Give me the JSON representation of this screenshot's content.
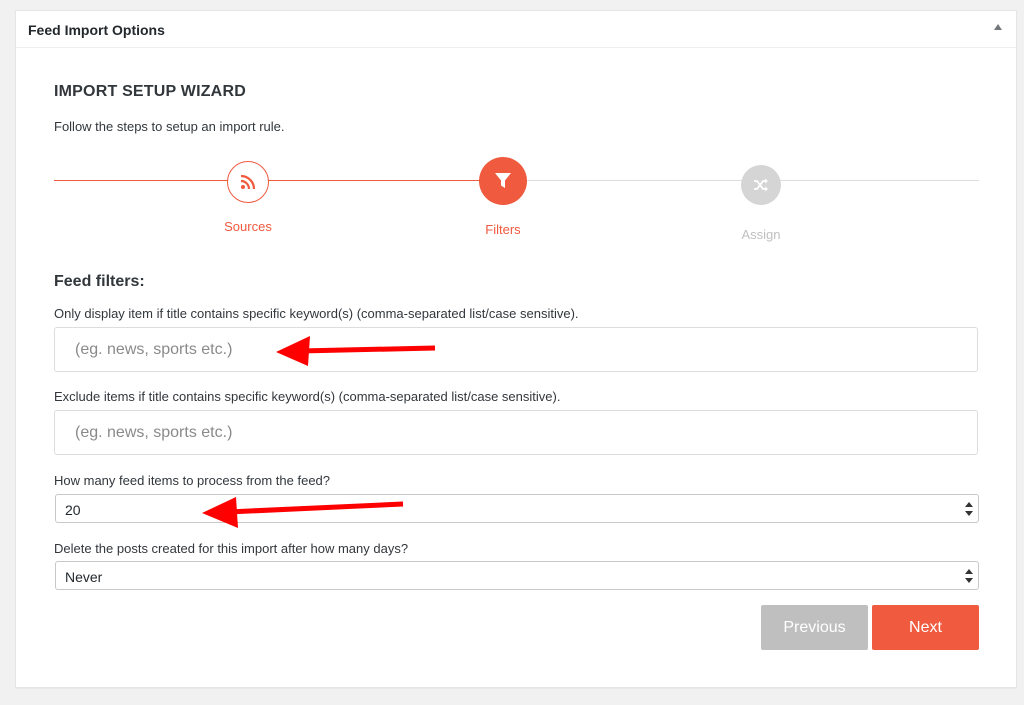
{
  "panel": {
    "title": "Feed Import Options"
  },
  "wizard": {
    "title": "IMPORT SETUP WIZARD",
    "subtitle": "Follow the steps to setup an import rule.",
    "steps": [
      {
        "label": "Sources",
        "icon": "rss-icon",
        "state": "completed"
      },
      {
        "label": "Filters",
        "icon": "filter-icon",
        "state": "active"
      },
      {
        "label": "Assign",
        "icon": "shuffle-icon",
        "state": "inactive"
      }
    ]
  },
  "filters": {
    "section_title": "Feed filters:",
    "include_label": "Only display item if title contains specific keyword(s) (comma-separated list/case sensitive).",
    "include_placeholder": "(eg. news, sports etc.)",
    "include_value": "",
    "exclude_label": "Exclude items if title contains specific keyword(s) (comma-separated list/case sensitive).",
    "exclude_placeholder": "(eg. news, sports etc.)",
    "exclude_value": "",
    "count_label": "How many feed items to process from the feed?",
    "count_value": "20",
    "delete_label": "Delete the posts created for this import after how many days?",
    "delete_value": "Never"
  },
  "buttons": {
    "previous": "Previous",
    "next": "Next"
  },
  "colors": {
    "accent": "#f05a3e",
    "inactive": "#d5d5d5",
    "button_disabled": "#bfbfbf",
    "annotation_arrow": "#ff0000"
  }
}
